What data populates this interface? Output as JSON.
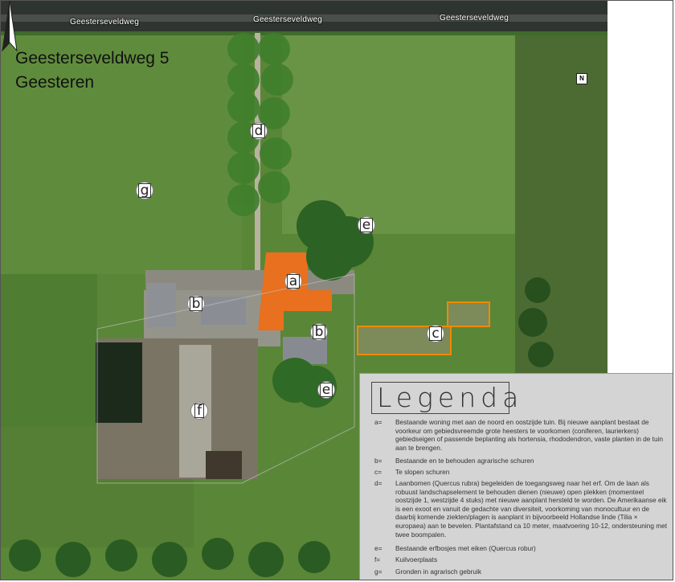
{
  "map": {
    "title_line1": "Geesterseveldweg 5",
    "title_line2": "Geesteren",
    "street_labels": [
      "Geesterseveldweg",
      "Geesterseveldweg",
      "Geesterseveldweg"
    ],
    "north_label": "N",
    "markers": [
      "d",
      "g",
      "e",
      "a",
      "b",
      "b",
      "c",
      "e",
      "f"
    ],
    "colors": {
      "field": "#5d8a3a",
      "field_dark": "#4a7a2e",
      "road": "#3a3f3a",
      "building_orange": "#e8701e",
      "roof_grey": "#8a8e94",
      "tree": "#2f6b25",
      "demolish_outline": "#f08a00"
    }
  },
  "legend": {
    "title": "Legenda",
    "items": [
      {
        "key": "a=",
        "text": "Bestaande woning met aan de noord en oostzijde tuin. Bij nieuwe aanplant bestaat de voorkeur om gebiedsvreemde grote heesters te voorkomen (coniferen, laurierkers) gebiedseigen of passende beplanting als hortensia, rhododendron, vaste planten in de tuin aan te brengen."
      },
      {
        "key": "b=",
        "text": "Bestaande en te behouden agrarische schuren"
      },
      {
        "key": "c=",
        "text": "Te slopen schuren"
      },
      {
        "key": "d=",
        "text": "Laanbomen (Quercus rubra) begeleiden de toegangsweg naar het erf. Om de laan als robuust landschapselement te behouden dienen (nieuwe) open plekken (momenteel oostzijde 1, westzijde 4 stuks) met nieuwe aanplant hersteld te worden. De Amerikaanse eik is een exoot en vanuit de gedachte van diversiteit, voorkoming van monocultuur en de daarbij komende ziekten/plagen is aanplant in bijvoorbeeld Hollandse linde (Tilia × europaea) aan te bevelen. Plantafstand ca 10 meter, maatvoering 10-12, ondersteuning met twee boompalen."
      },
      {
        "key": "e=",
        "text": "Bestaande erfbosjes met eiken (Quercus robur)"
      },
      {
        "key": "f=",
        "text": "Kuilvoerplaats"
      },
      {
        "key": "g=",
        "text": "Gronden in agrarisch gebruik"
      }
    ]
  }
}
